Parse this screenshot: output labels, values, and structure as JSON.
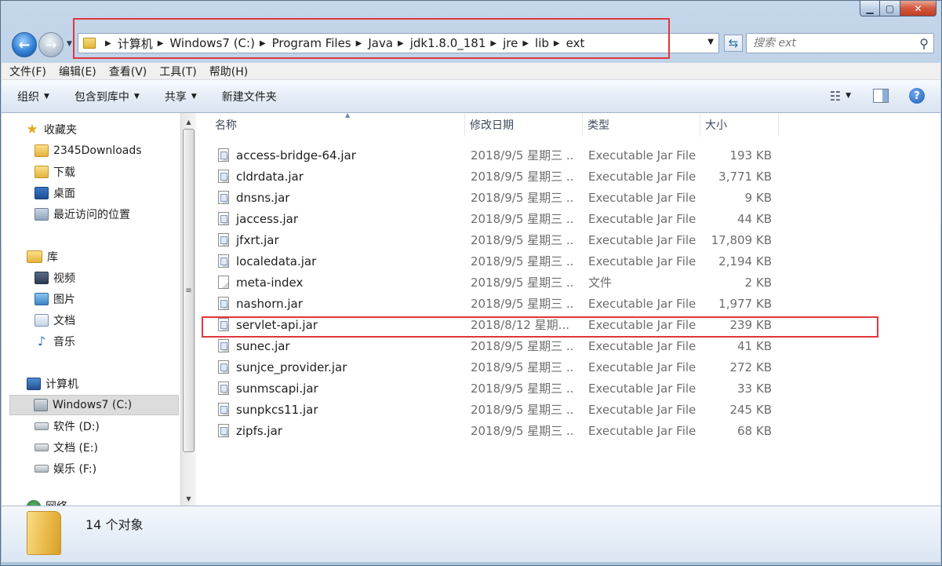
{
  "window": {
    "minimize": "▁",
    "maximize": "▢",
    "close": "✕"
  },
  "nav": {
    "back": "←",
    "forward": "→"
  },
  "address": {
    "crumbs": [
      "计算机",
      "Windows7 (C:)",
      "Program Files",
      "Java",
      "jdk1.8.0_181",
      "jre",
      "lib",
      "ext"
    ]
  },
  "search": {
    "placeholder": "搜索 ext"
  },
  "menubar": {
    "items": [
      "文件(F)",
      "编辑(E)",
      "查看(V)",
      "工具(T)",
      "帮助(H)"
    ]
  },
  "toolbar": {
    "organize": "组织",
    "include_library": "包含到库中",
    "share": "共享",
    "new_folder": "新建文件夹"
  },
  "sidebar": {
    "favorites": {
      "label": "收藏夹",
      "items": [
        "2345Downloads",
        "下载",
        "桌面",
        "最近访问的位置"
      ]
    },
    "libraries": {
      "label": "库",
      "items": [
        "视频",
        "图片",
        "文档",
        "音乐"
      ]
    },
    "computer": {
      "label": "计算机",
      "items": [
        "Windows7 (C:)",
        "软件 (D:)",
        "文档 (E:)",
        "娱乐 (F:)"
      ]
    },
    "network": {
      "label": "网络"
    }
  },
  "columns": {
    "name": "名称",
    "date": "修改日期",
    "type": "类型",
    "size": "大小"
  },
  "files": [
    {
      "name": "access-bridge-64.jar",
      "date": "2018/9/5 星期三 ...",
      "type": "Executable Jar File",
      "size": "193 KB"
    },
    {
      "name": "cldrdata.jar",
      "date": "2018/9/5 星期三 ...",
      "type": "Executable Jar File",
      "size": "3,771 KB"
    },
    {
      "name": "dnsns.jar",
      "date": "2018/9/5 星期三 ...",
      "type": "Executable Jar File",
      "size": "9 KB"
    },
    {
      "name": "jaccess.jar",
      "date": "2018/9/5 星期三 ...",
      "type": "Executable Jar File",
      "size": "44 KB"
    },
    {
      "name": "jfxrt.jar",
      "date": "2018/9/5 星期三 ...",
      "type": "Executable Jar File",
      "size": "17,809 KB"
    },
    {
      "name": "localedata.jar",
      "date": "2018/9/5 星期三 ...",
      "type": "Executable Jar File",
      "size": "2,194 KB"
    },
    {
      "name": "meta-index",
      "date": "2018/9/5 星期三 ...",
      "type": "文件",
      "size": "2 KB"
    },
    {
      "name": "nashorn.jar",
      "date": "2018/9/5 星期三 ...",
      "type": "Executable Jar File",
      "size": "1,977 KB"
    },
    {
      "name": "servlet-api.jar",
      "date": "2018/8/12 星期...",
      "type": "Executable Jar File",
      "size": "239 KB"
    },
    {
      "name": "sunec.jar",
      "date": "2018/9/5 星期三 ...",
      "type": "Executable Jar File",
      "size": "41 KB"
    },
    {
      "name": "sunjce_provider.jar",
      "date": "2018/9/5 星期三 ...",
      "type": "Executable Jar File",
      "size": "272 KB"
    },
    {
      "name": "sunmscapi.jar",
      "date": "2018/9/5 星期三 ...",
      "type": "Executable Jar File",
      "size": "33 KB"
    },
    {
      "name": "sunpkcs11.jar",
      "date": "2018/9/5 星期三 ...",
      "type": "Executable Jar File",
      "size": "245 KB"
    },
    {
      "name": "zipfs.jar",
      "date": "2018/9/5 星期三 ...",
      "type": "Executable Jar File",
      "size": "68 KB"
    }
  ],
  "status": {
    "count_text": "14 个对象"
  },
  "colors": {
    "highlight": "#e0373b",
    "accent": "#2f7fd4"
  }
}
